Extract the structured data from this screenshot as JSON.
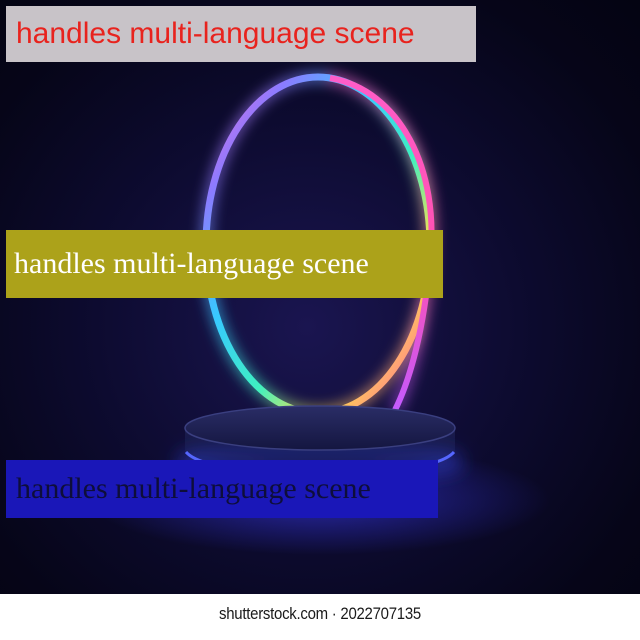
{
  "captions": [
    {
      "text": "handles multi-language scene",
      "text_color": "#e8231e",
      "background": "#c8c3c8"
    },
    {
      "text": "handles multi-language scene",
      "text_color": "#ffffff",
      "background": "#aca21a"
    },
    {
      "text": "handles multi-language scene",
      "text_color": "#0e0e3a",
      "background": "#1a17b8"
    }
  ],
  "watermark": {
    "text": "shutterstock.com · 2022707135"
  },
  "scene": {
    "background_color": "#0d0b30",
    "ring_colors": [
      "#ff5fd0",
      "#b86bff",
      "#3fd0ff",
      "#46f0c8",
      "#ffe14a",
      "#ff4fa8"
    ],
    "podium_color": "#1c1f4a",
    "podium_glow": "#3347ff"
  }
}
